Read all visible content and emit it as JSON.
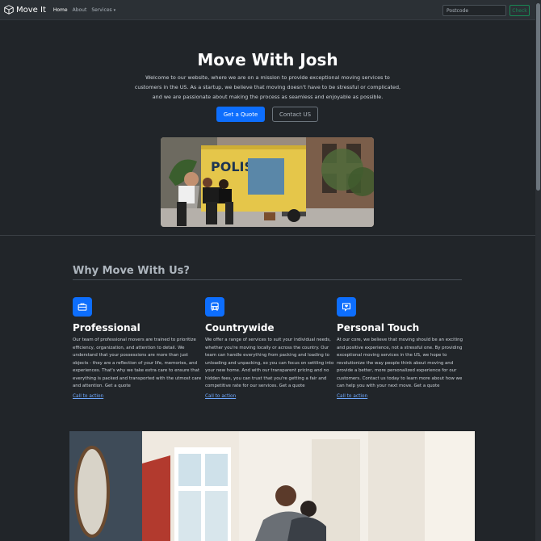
{
  "navbar": {
    "brand": "Move It",
    "links": [
      "Home",
      "About",
      "Services"
    ],
    "search_placeholder": "Postcode",
    "check_label": "Check"
  },
  "hero": {
    "title": "Move With Josh",
    "lead": "Welcome to our website, where we are on a mission to provide exceptional moving services to customers in the US. As a startup, we believe that moving doesn't have to be stressful or complicated, and we are passionate about making the process as seamless and enjoyable as possible.",
    "primary_button": "Get a Quote",
    "secondary_button": "Contact US",
    "truck_text": "POLIS"
  },
  "features": {
    "title": "Why Move With Us?",
    "items": [
      {
        "icon": "briefcase-icon",
        "heading": "Professional",
        "text": "Our team of professional movers are trained to prioritize efficiency, organization, and attention to detail. We understand that your possessions are more than just objects - they are a reflection of your life, memories, and experiences. That's why we take extra care to ensure that everything is packed and transported with the utmost care and attention. Get a quote",
        "cta": "Call to action"
      },
      {
        "icon": "bus-icon",
        "heading": "Countrywide",
        "text": "We offer a range of services to suit your individual needs, whether you're moving locally or across the country. Our team can handle everything from packing and loading to unloading and unpacking, so you can focus on settling into your new home. And with our transparent pricing and no hidden fees, you can trust that you're getting a fair and competitive rate for our services. Get a quote",
        "cta": "Call to action"
      },
      {
        "icon": "heart-chat-icon",
        "heading": "Personal Touch",
        "text": "At our core, we believe that moving should be an exciting and positive experience, not a stressful one. By providing exceptional moving services in the US, we hope to revolutionize the way people think about moving and provide a better, more personalized experience for our customers. Contact us today to learn more about how we can help you with your next move. Get a quote",
        "cta": "Call to action"
      }
    ]
  }
}
